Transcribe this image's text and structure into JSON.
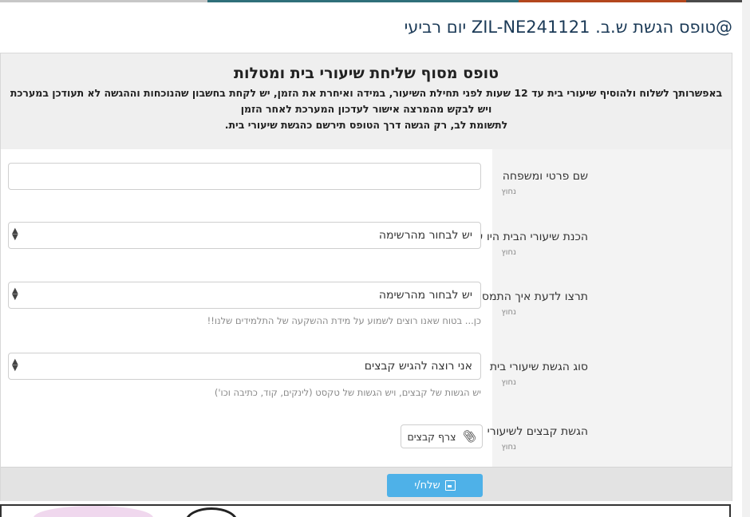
{
  "page": {
    "title": "@טופס הגשת ש.ב. ZIL-NE241121 יום רביעי"
  },
  "form": {
    "heading": "טופס מסוף שליחת שיעורי בית ומטלות",
    "description": "באפשרותך לשלוח ולהוסיף שיעורי בית עד 12 שעות לפני תחילת השיעור, במידה ואיחרת את הזמן, יש לקחת בחשבון שהנוכחות וההגשה לא תעודכן במערכת ויש לבקש מהמרצה אישור לעדכון המערכת לאחר הזמן",
    "note": "לתשומת לב, רק הגשה דרך הטופס תירשם כהגשת שיעורי בית.",
    "required_label": "נחוץ",
    "fields": {
      "name": {
        "label": "שם פרטי ומשפחה",
        "value": ""
      },
      "prep": {
        "label": "הכנת שיעורי הבית היו עבורי",
        "value": "יש לבחור מהרשימה"
      },
      "feeling": {
        "label": "תרצו לדעת איך התמסרתי?",
        "value": "יש לבחור מהרשימה",
        "hint": "כן... בטוח שאנו רוצים לשמוע על מידת ההשקעה של התלמידים שלנו!!"
      },
      "type": {
        "label": "סוג הגשת שיעורי בית",
        "value": "אני רוצה להגיש קבצים",
        "hint": "יש הגשות של קבצים, ויש הגשות של טקסט (לינקים, קוד, כתיבה וכו')"
      },
      "files": {
        "label": "הגשת קבצים לשיעורי הבית",
        "button": "צרף קבצים"
      }
    },
    "submit_label": "שלח/י"
  },
  "icons": {
    "select_arrows": "sort-arrows-icon",
    "attach": "paperclip-icon",
    "submit": "save-icon"
  },
  "colors": {
    "title": "#1b3a57",
    "submit_bg": "#4eb1e8",
    "header_bg": "#efefef",
    "footer_bg": "#e3e3e3"
  }
}
